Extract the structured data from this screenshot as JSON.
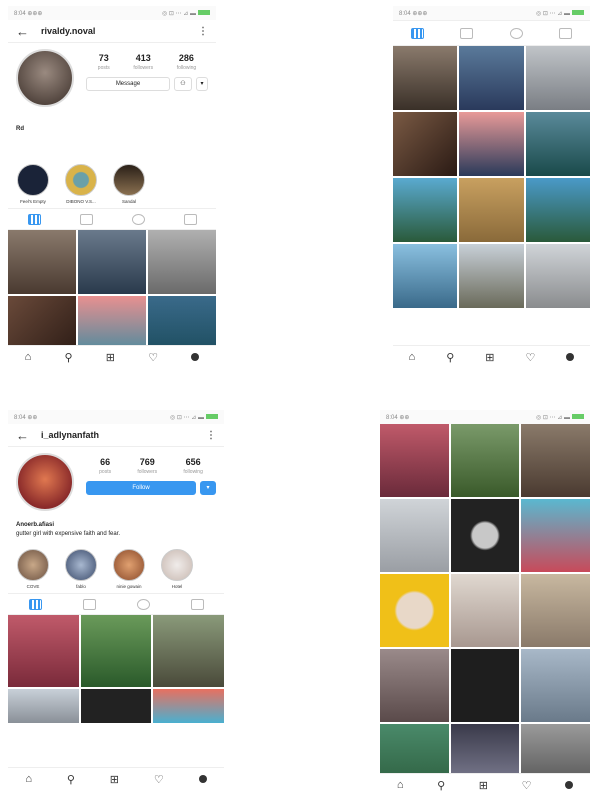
{
  "phone1": {
    "status_left": "8:04 ⊕⊕⊕",
    "status_right": "◎ ⊡ ⋯ ⊿ ▬",
    "username": "rivaldy.noval",
    "stats": [
      {
        "value": "73",
        "label": "posts"
      },
      {
        "value": "413",
        "label": "followers"
      },
      {
        "value": "286",
        "label": "following"
      }
    ],
    "message_label": "Message",
    "bio_name": "Rd",
    "highlights": [
      {
        "label": "Feel's Empty",
        "color": "#1a2338"
      },
      {
        "label": "DIBONO V.S...",
        "color": "#d9b34a"
      },
      {
        "label": "Sandal",
        "color": "#5a4430"
      }
    ],
    "grid_colors": [
      "#6a5a4c",
      "#4e6a7c",
      "#8c8c8c",
      "#5a3e30",
      "#3e8a9a",
      "#1e5a6a"
    ]
  },
  "phone2": {
    "status_left": "8:04 ⊕⊕⊕",
    "status_right": "◎ ⊡ ⋯ ⊿ ▬",
    "grid_colors": [
      "#5e5048",
      "#3a5a7a",
      "#9aa0a8",
      "#4a3a32",
      "#d68a86",
      "#2a5e6e",
      "#3a6a4a",
      "#b28a4a",
      "#3a8aaa",
      "#4a8ab0",
      "#6a6a5a",
      "#888a8c"
    ]
  },
  "phone3": {
    "status_left": "8:04 ⊕⊕",
    "status_right": "◎ ⊡ ⋯ ⊿ ▬",
    "username": "i_adlynanfath",
    "stats": [
      {
        "value": "66",
        "label": "posts"
      },
      {
        "value": "769",
        "label": "followers"
      },
      {
        "value": "656",
        "label": "following"
      }
    ],
    "follow_label": "Follow",
    "bio_name": "Anoerb.afiasi",
    "bio_text": "gutter girl with expensive faith and fear.",
    "highlights": [
      {
        "label": "COVE",
        "color": "#a88870"
      },
      {
        "label": "fablo",
        "color": "#6a7a9a"
      },
      {
        "label": "ninie gowain",
        "color": "#b07850"
      },
      {
        "label": "Hotel",
        "color": "#e8e4e0"
      }
    ],
    "grid_colors": [
      "#b04a5a",
      "#4a7a3a",
      "#6a7a5a",
      "#b0b8c0",
      "#222222",
      "#4aa8c8"
    ]
  },
  "phone4": {
    "status_left": "8:04 ⊕⊕",
    "status_right": "◎ ⊡ ⋯ ⊿ ▬",
    "grid_colors": [
      "#a8485a",
      "#5a7a4a",
      "#6a5a4a",
      "#b8bcc0",
      "#333333",
      "#4aa8c0",
      "#e8b818",
      "#c8c0b8",
      "#a89880",
      "#7a6a6a",
      "#222222",
      "#8a9aa8",
      "#5a7a5a",
      "#9a8a7a",
      "#6a6a6a"
    ]
  }
}
